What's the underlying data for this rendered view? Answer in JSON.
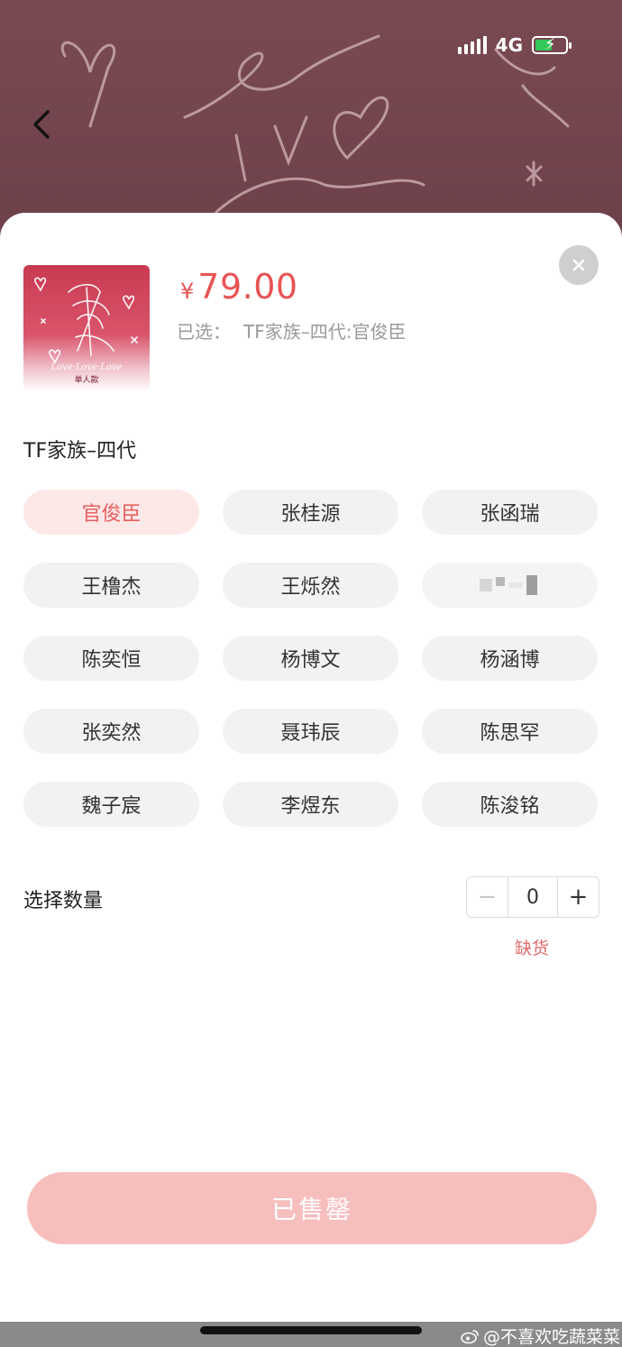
{
  "status_bar": {
    "network": "4G"
  },
  "product": {
    "currency_symbol": "¥",
    "price": "79.00",
    "selected_prefix": "已选：",
    "selected_value": "TF家族–四代:官俊臣"
  },
  "spec_group": {
    "title": "TF家族–四代",
    "options": [
      {
        "label": "官俊臣",
        "state": "selected"
      },
      {
        "label": "张桂源",
        "state": "normal"
      },
      {
        "label": "张函瑞",
        "state": "normal"
      },
      {
        "label": "王橹杰",
        "state": "normal"
      },
      {
        "label": "王烁然",
        "state": "normal"
      },
      {
        "label": "",
        "state": "censored"
      },
      {
        "label": "陈奕恒",
        "state": "normal"
      },
      {
        "label": "杨博文",
        "state": "normal"
      },
      {
        "label": "杨涵博",
        "state": "normal"
      },
      {
        "label": "张奕然",
        "state": "normal"
      },
      {
        "label": "聂玮辰",
        "state": "normal"
      },
      {
        "label": "陈思罕",
        "state": "normal"
      },
      {
        "label": "魏子宸",
        "state": "normal"
      },
      {
        "label": "李煜东",
        "state": "normal"
      },
      {
        "label": "陈浚铭",
        "state": "normal"
      }
    ]
  },
  "quantity": {
    "label": "选择数量",
    "value": "0",
    "minus": "−",
    "plus": "+",
    "stock_note": "缺货"
  },
  "action": {
    "button_label": "已售罄"
  },
  "watermark": {
    "text": "@不喜欢吃蔬菜菜"
  },
  "colors": {
    "price": "#e85454",
    "selected_chip_bg": "#fde8e8",
    "selected_chip_text": "#e86060",
    "soldout_button": "#f7bebe"
  }
}
